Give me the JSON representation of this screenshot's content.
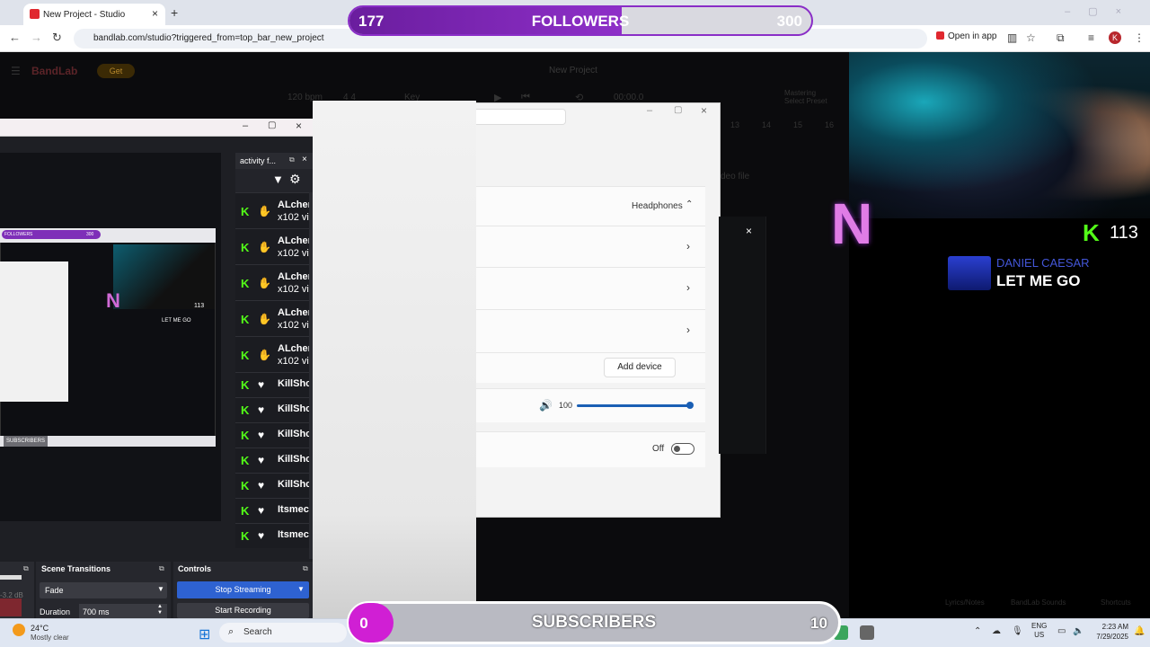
{
  "browser": {
    "tab_title": "New Project - Studio",
    "url": "bandlab.com/studio?triggered_from=top_bar_new_project",
    "open_in_app": "Open in app",
    "profile_initial": "K"
  },
  "followers_goal": {
    "current": "177",
    "label": "FOLLOWERS",
    "goal": "300",
    "progress": 0.59
  },
  "bandlab": {
    "logo": "BandLab",
    "get_button": "Get",
    "project_title": "New Project",
    "bpm": "120 bpm",
    "time_signature": "4   4",
    "key": "Key",
    "time": "00:00.0",
    "mastering": "Mastering",
    "mastering_sub": "Select Preset",
    "video_label": "deo file",
    "ruler": [
      "13",
      "14",
      "15",
      "16"
    ],
    "lyrics_notes": "Lyrics/Notes",
    "sounds": "BandLab Sounds",
    "shortcuts": "Shortcuts"
  },
  "settings": {
    "device_label": "Headphones",
    "add_device": "Add device",
    "volume": "100",
    "volume_level": 1.0,
    "toggle_label": "Off"
  },
  "obs": {
    "activity_feed_title": "activity f...",
    "feed": [
      {
        "icon": "hands-icon",
        "name": "ALcher",
        "sub": "x102 vi"
      },
      {
        "icon": "hands-icon",
        "name": "ALcher",
        "sub": "x102 vi"
      },
      {
        "icon": "hands-icon",
        "name": "ALcher",
        "sub": "x102 vi"
      },
      {
        "icon": "hands-icon",
        "name": "ALcher",
        "sub": "x102 vi"
      },
      {
        "icon": "hands-icon",
        "name": "ALcher",
        "sub": "x102 vi"
      },
      {
        "icon": "heart-icon",
        "name": "KillSho",
        "sub": ""
      },
      {
        "icon": "heart-icon",
        "name": "KillSho",
        "sub": ""
      },
      {
        "icon": "heart-icon",
        "name": "KillSho",
        "sub": ""
      },
      {
        "icon": "heart-icon",
        "name": "KillSho",
        "sub": ""
      },
      {
        "icon": "heart-icon",
        "name": "KillSho",
        "sub": ""
      },
      {
        "icon": "heart-icon",
        "name": "Itsmec",
        "sub": ""
      },
      {
        "icon": "heart-icon",
        "name": "Itsmec",
        "sub": ""
      }
    ],
    "mini_preview": {
      "followers": "FOLLOWERS",
      "goal": "300",
      "k_count": "113",
      "song": "LET ME GO",
      "subscribers": "SUBSCRIBERS"
    },
    "audio_db": "-3.2 dB",
    "scene_transitions_title": "Scene Transitions",
    "transition": "Fade",
    "duration_label": "Duration",
    "duration_value": "700 ms",
    "controls_title": "Controls",
    "stop_streaming": "Stop Streaming",
    "start_recording": "Start Recording"
  },
  "stream_overlay": {
    "kick_count": "113",
    "artist": "DANIEL CAESAR",
    "song": "LET ME GO",
    "n_logo": "N"
  },
  "subscribers_goal": {
    "current": "0",
    "label": "SUBSCRIBERS",
    "goal": "10"
  },
  "taskbar": {
    "weather_temp": "24°C",
    "weather_desc": "Mostly clear",
    "search_placeholder": "Search",
    "lang_line1": "ENG",
    "lang_line2": "US",
    "time": "2:23 AM",
    "date": "7/29/2025"
  },
  "colors": {
    "followers_fill": "#8e2fc8",
    "kick_green": "#53fc18",
    "subs_bubble": "#d01fd4",
    "obs_stop_stream": "#2e62d1"
  }
}
